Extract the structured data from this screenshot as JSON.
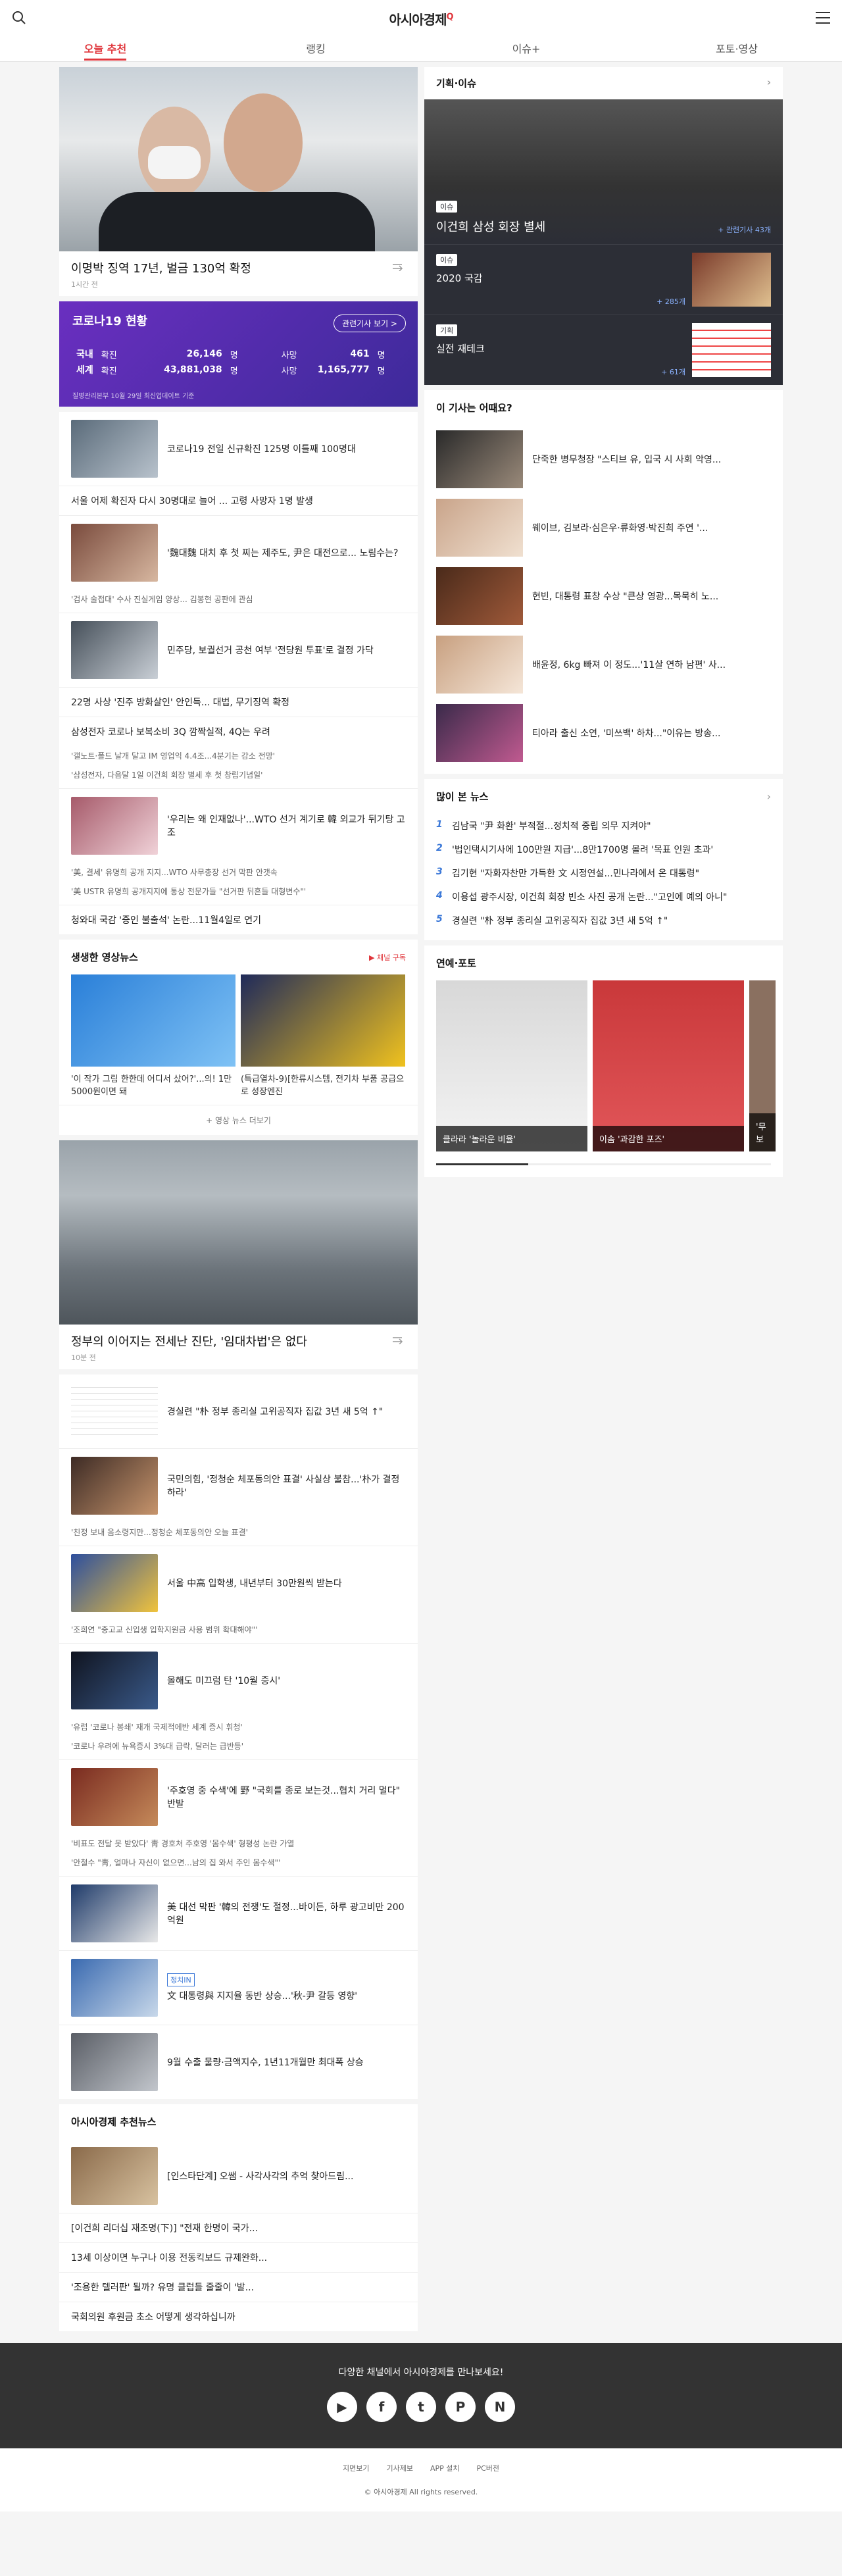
{
  "header": {
    "title": "아시아경제",
    "mark": "Q"
  },
  "nav": {
    "tabs": [
      "오늘 추천",
      "랭킹",
      "이슈+",
      "포토·영상"
    ]
  },
  "hero": {
    "title": "이명박 징역 17년, 벌금 130억 확정",
    "time": "1시간 전"
  },
  "covid": {
    "title": "코로나19 현황",
    "button": "관련기사 보기 >",
    "rows": [
      {
        "label": "국내",
        "k1": "확진",
        "v1": "26,146",
        "u1": "명",
        "k2": "사망",
        "v2": "461",
        "u2": "명"
      },
      {
        "label": "세계",
        "k1": "확진",
        "v1": "43,881,038",
        "u1": "명",
        "k2": "사망",
        "v2": "1,165,777",
        "u2": "명"
      }
    ],
    "source": "질병관리본부 10월 29일 최신업데이트 기준"
  },
  "news1": [
    {
      "t": "코로나19 전일 신규확진 125명 이틀째 100명대",
      "img": true
    },
    {
      "t": "서울 어제 확진자 다시 30명대로 늘어 ... 고령 사망자 1명 발생",
      "img": false
    },
    {
      "t": "'魏대魏 대치 후 첫 찌는 제주도, 尹은 대전으로... 노림수는?",
      "img": true,
      "sub": "'검사 술접대' 수사 진실게임 양상... 김봉현 공판에 관심"
    },
    {
      "t": "민주당, 보궐선거 공천 여부 '전당원 투표'로 결정 가닥",
      "img": true
    },
    {
      "t": "22명 사상 '진주 방화살인' 안인득... 대법, 무기징역 확정",
      "img": false
    },
    {
      "t": "삼성전자 코로나 보복소비 3Q 깜짝실적, 4Q는 우려",
      "img": false,
      "subs": [
        "'갤노트·폴드 날개 달고 IM 영업익 4.4조...4분기는 감소 전망'",
        "'삼성전자, 다음달 1일 이건희 회장 별세 후 첫 창립기념일'"
      ]
    },
    {
      "t": "'우리는 왜 인재없나'...WTO 선거 계기로 韓 외교가 뒤기탕 고조",
      "img": true,
      "subs": [
        "'美, 결세' 유명희 공개 지지...WTO 사무총장 선거 막판 안갯속",
        "'美 USTR 유명희 공개지지에 통상 전문가들 \"선거판 뒤흔들 대형변수\"'"
      ]
    },
    {
      "t": "청와대 국감 '증인 불출석' 논란...11월4일로 연기",
      "img": false
    }
  ],
  "video": {
    "title": "생생한 영상뉴스",
    "channel": "채널 구독",
    "items": [
      "'이 작가 그림 한한데 어디서 샀어?'...의! 1만5000원이면 돼",
      "(특급열차-9)[한류시스템, 전기차 부품 공급으로 성장엔진"
    ],
    "more": "+ 영상 뉴스 더보기"
  },
  "hero2": {
    "title": "정부의 이어지는 전세난 진단, '임대차법'은 없다",
    "time": "10분 전"
  },
  "news2": [
    {
      "t": "경실련 \"朴 정부 종리실 고위공직자 집값 3년 새 5억 ↑\""
    },
    {
      "t": "국민의힘, '정청순 체포동의안 표결' 사실상 불참...'朴가 결정하라'",
      "sub": "'친정 보내 음소령지만...정청순 체포동의안 오늘 표결'"
    },
    {
      "t": "서울 中高 입학생, 내년부터 30만원씩 받는다",
      "sub": "'조희연 \"중고교 신입생 입학지원금 사용 범위 확대해야\"'"
    },
    {
      "t": "올해도 미끄럼 탄 '10월 증시'",
      "subs": [
        "'유럽 '코로나 봉쇄' 재개 국제적에반 세계 증시 휘청'",
        "'코로나 우려에 뉴욕증시 3%대 급락, 달러는 급반등'"
      ]
    },
    {
      "t": "'주호영 중 수색'에 野 \"국회를 종로 보는것...협치 거리 멀다\" 반발",
      "subs": [
        "'비표도 전달 못 받았다' 靑 경호처 주호영 '몸수색' 형평성 논란 가열",
        "'안철수 \"靑, 얼마나 자신이 없으면...남의 집 와서 주인 몸수색\"'"
      ]
    },
    {
      "t": "美 대선 막판 '韓의 전쟁'도 절정...바이든, 하루 광고비만 200억원"
    },
    {
      "t": "文 대통령與 지지율 동반 상승...'秋-尹 갈등 영향'",
      "badge": "정치IN"
    },
    {
      "t": "9월 수출 물량·금액지수, 1년11개월만 최대폭 상승"
    }
  ],
  "recommend": {
    "title": "아시아경제 추천뉴스",
    "items": [
      "[인스타단계] 오쌤 - 사각사각의 추억 찾아드림...",
      "[이건희 리더십 재조명(下)] \"전재 한명이 국가...",
      "13세 이상이면 누구나 이용 전동킥보드 규제완화...",
      "'조용한 텔러판' 될까? 유명 클럽들 줄줄이 '발...",
      "국회의원 후원금 초소 어떻게 생각하십니까"
    ]
  },
  "issue": {
    "title": "기획·이슈",
    "badge": "이슈",
    "headline": "이건희 삼성 회장 별세",
    "more1": "+ 관련기사 43개",
    "rows": [
      {
        "badge": "이슈",
        "t": "2020 국감",
        "more": "+ 285개"
      },
      {
        "badge": "기획",
        "t": "실전 재테크",
        "more": "+ 61개"
      }
    ]
  },
  "recommended": {
    "title": "이 기사는 어때요?",
    "items": [
      "단죽한 병무청장 \"스티브 유, 입국 시 사회 악영...",
      "웨이브, 김보라·심은우·류화영·박진희 주연 '...",
      "현빈, 대통령 표창 수상 \"큰상 영광...목묵히 노...",
      "배윤정, 6kg 빠져 이 정도...'11살 연하 남편' 사...",
      "티아라 출신 소연, '미쓰백' 하차...\"이유는 방송..."
    ]
  },
  "popular": {
    "title": "많이 본 뉴스",
    "items": [
      "김남국 \"尹 화환' 부적절...정치적 중립 의무 지켜야\"",
      "'법인택시기사에 100만원 지급'...8만1700명 몰려 '목표 인원 초과'",
      "김기현 \"자화자찬만 가득한 文 시정연설...민나라에서 온 대통령\"",
      "이용섭 광주시장, 이건희 회장 빈소 사진 공개 논란...\"고인에 예의 아니\"",
      "경실련 \"朴 정부 종리실 고위공직자 집값 3년 새 5억 ↑\""
    ]
  },
  "photo": {
    "title": "연예·포토",
    "items": [
      "클라라 '놀라운 비율'",
      "이솜 '과감한 포즈'",
      "'무보"
    ]
  },
  "footer": {
    "title": "다양한 채널에서 아시아경제를 만나보세요!",
    "sns": [
      "▶",
      "f",
      "t",
      "P",
      "N"
    ],
    "links": [
      "지면보기",
      "기사제보",
      "APP 설치",
      "PC버전"
    ],
    "copy": "© 아시아경제 All rights reserved."
  }
}
